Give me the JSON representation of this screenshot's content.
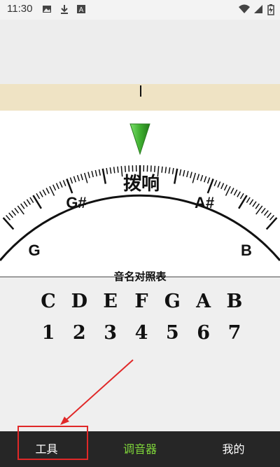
{
  "status_bar": {
    "time": "11:30",
    "icons": [
      "image-icon",
      "download-icon",
      "a-icon",
      "wifi-icon",
      "signal-icon",
      "battery-charging-icon"
    ]
  },
  "tuner": {
    "note_left": "G",
    "note_mid_left": "G#",
    "center_label": "拨响",
    "note_mid_right": "A#",
    "note_right": "B",
    "pointer_color": "#3faf30",
    "band_color": "#efe3c4"
  },
  "note_table": {
    "title": "音名对照表",
    "notes": [
      "C",
      "D",
      "E",
      "F",
      "G",
      "A",
      "B"
    ],
    "numbers": [
      "1",
      "2",
      "3",
      "4",
      "5",
      "6",
      "7"
    ]
  },
  "nav": {
    "tools": "工具",
    "tuner": "调音器",
    "mine": "我的",
    "active_color": "#7fd63a"
  }
}
